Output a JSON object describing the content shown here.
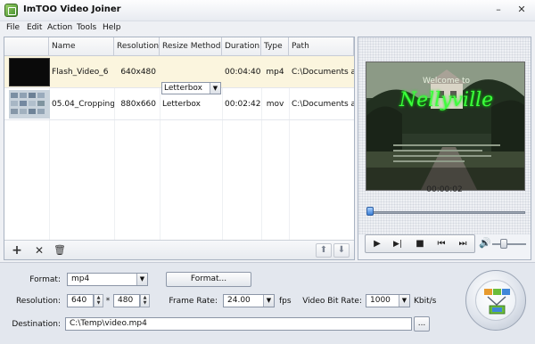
{
  "window": {
    "title": "ImTOO Video Joiner",
    "min": "–",
    "close": "✕"
  },
  "menu": [
    "File",
    "Edit",
    "Action",
    "Tools",
    "Help"
  ],
  "table": {
    "headers": [
      "Name",
      "Resolution",
      "Resize Method",
      "Duration",
      "Type",
      "Path"
    ],
    "rows": [
      {
        "name": "Flash_Video_6",
        "resolution": "640x480",
        "resize": "Letterbox",
        "duration": "00:04:40",
        "type": "mp4",
        "path": "C:\\Documents and"
      },
      {
        "name": "05.04_Cropping",
        "resolution": "880x660",
        "resize": "Letterbox",
        "duration": "00:02:42",
        "type": "mov",
        "path": "C:\\Documents and"
      }
    ]
  },
  "toolbar": {
    "add": "+",
    "remove": "✕",
    "delete": "🗑",
    "up": "⬆",
    "down": "⬇"
  },
  "preview": {
    "overlay_top": "Welcome to",
    "overlay_title": "Nellyville",
    "timecode": "00:00:02",
    "seek_fraction": 0.02
  },
  "controls": {
    "play": "▶",
    "play_range": "▶|",
    "stop": "■",
    "prev": "⏮",
    "next": "⏭",
    "volume": "🔊"
  },
  "settings": {
    "format_label": "Format:",
    "format_value": "mp4",
    "format_button": "Format...",
    "resolution_label": "Resolution:",
    "width": "640",
    "times": "*",
    "height": "480",
    "framerate_label": "Frame Rate:",
    "framerate_value": "24.00",
    "fps": "fps",
    "vbr_label": "Video Bit Rate:",
    "vbr_value": "1000",
    "kbits": "Kbit/s",
    "destination_label": "Destination:",
    "destination_value": "C:\\Temp\\video.mp4",
    "browse": "..."
  }
}
